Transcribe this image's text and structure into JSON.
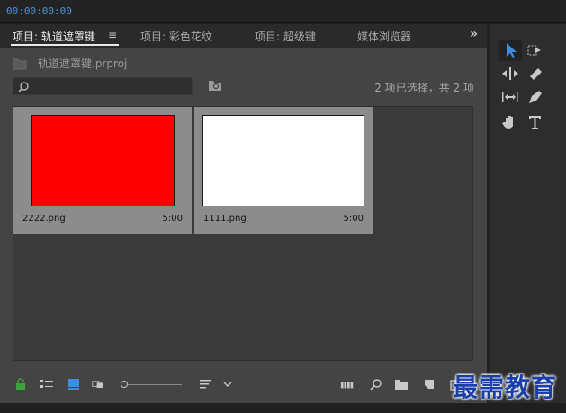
{
  "timecode": "00:00:00:00",
  "project_panel": {
    "tabs": [
      {
        "label": "项目: 轨道遮罩键",
        "active": true
      },
      {
        "label": "项目: 彩色花纹",
        "active": false
      },
      {
        "label": "项目: 超级键",
        "active": false
      },
      {
        "label": "媒体浏览器",
        "active": false
      }
    ],
    "tab_menu_glyph": "≡",
    "tabs_overflow_glyph": "»",
    "project_file": "轨道遮罩键.prproj",
    "search": {
      "value": "",
      "placeholder": ""
    },
    "selection_status": "2 项已选择，共 2 项",
    "clips": [
      {
        "name": "2222.png",
        "duration": "5:00",
        "color": "#ff0000"
      },
      {
        "name": "1111.png",
        "duration": "5:00",
        "color": "#ffffff"
      }
    ]
  },
  "bottom_toolbar": {
    "icons": [
      "lock-icon",
      "list-view-icon",
      "icon-view-icon",
      "freeform-view-icon",
      "zoom-slider",
      "sort-icon",
      "sort-dropdown-icon",
      "automate-to-sequence-icon",
      "find-icon",
      "new-bin-icon",
      "new-item-icon",
      "clear-icon"
    ]
  },
  "tools_panel": {
    "tools": [
      "selection-tool-icon",
      "track-select-icon",
      "ripple-edit-icon",
      "razor-tool-icon",
      "slip-tool-icon",
      "pen-tool-icon",
      "hand-tool-icon",
      "type-tool-icon"
    ],
    "active_tool": "selection-tool-icon"
  },
  "watermark": "最需教育",
  "colors": {
    "accent": "#4a90d9",
    "panel_bg": "#444444",
    "tab_bg": "#2a2a2a",
    "tool_active": "#3a8ee6"
  }
}
